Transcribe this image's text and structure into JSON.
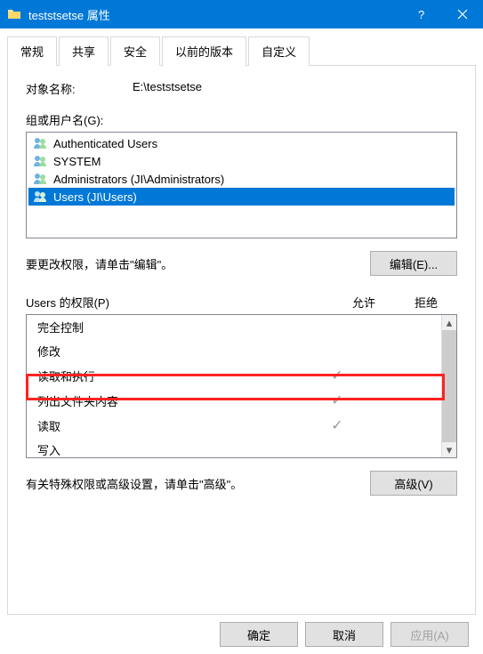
{
  "titlebar": {
    "title": "teststsetse 属性"
  },
  "tabs": {
    "items": [
      {
        "label": "常规"
      },
      {
        "label": "共享"
      },
      {
        "label": "安全"
      },
      {
        "label": "以前的版本"
      },
      {
        "label": "自定义"
      }
    ],
    "active_index": 2
  },
  "object": {
    "label": "对象名称:",
    "value": "E:\\teststsetse"
  },
  "group": {
    "label": "组或用户名(G):",
    "items": [
      {
        "name": "Authenticated Users"
      },
      {
        "name": "SYSTEM"
      },
      {
        "name": "Administrators (JI\\Administrators)"
      },
      {
        "name": "Users (JI\\Users)"
      }
    ],
    "selected_index": 3
  },
  "edit": {
    "message": "要更改权限，请单击\"编辑\"。",
    "button": "编辑(E)..."
  },
  "perm": {
    "header_prefix": "Users",
    "header_suffix": " 的权限(P)",
    "allow": "允许",
    "deny": "拒绝",
    "rows": [
      {
        "name": "完全控制",
        "allow": false,
        "deny": false
      },
      {
        "name": "修改",
        "allow": false,
        "deny": false
      },
      {
        "name": "读取和执行",
        "allow": true,
        "deny": false
      },
      {
        "name": "列出文件夹内容",
        "allow": true,
        "deny": false
      },
      {
        "name": "读取",
        "allow": true,
        "deny": false
      },
      {
        "name": "写入",
        "allow": false,
        "deny": false
      }
    ]
  },
  "adv": {
    "message": "有关特殊权限或高级设置，请单击\"高级\"。",
    "button": "高级(V)"
  },
  "footer": {
    "ok": "确定",
    "cancel": "取消",
    "apply": "应用(A)"
  }
}
